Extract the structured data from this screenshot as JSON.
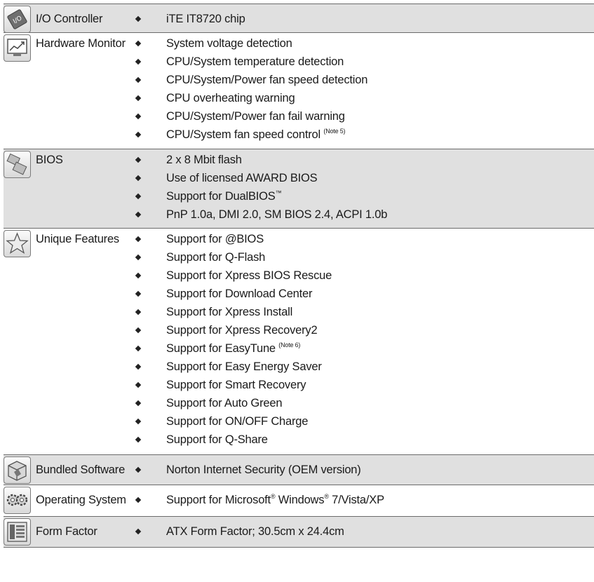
{
  "sections": [
    {
      "label": "I/O Controller",
      "icon": "io-chip-icon",
      "items": [
        "iTE IT8720 chip"
      ]
    },
    {
      "label": "Hardware Monitor",
      "icon": "monitor-graph-icon",
      "items": [
        "System voltage detection",
        "CPU/System temperature detection",
        "CPU/System/Power fan speed detection",
        "CPU overheating warning",
        "CPU/System/Power fan fail warning",
        "CPU/System fan speed control"
      ],
      "note": "(Note 5)"
    },
    {
      "label": "BIOS",
      "icon": "bios-chips-icon",
      "items": [
        "2 x 8 Mbit flash",
        "Use of licensed AWARD BIOS",
        "Support for DualBIOS",
        "PnP 1.0a, DMI 2.0, SM BIOS 2.4, ACPI 1.0b"
      ],
      "trademark": "™"
    },
    {
      "label": "Unique Features",
      "icon": "star-icon",
      "items": [
        "Support for @BIOS",
        "Support for Q-Flash",
        "Support for Xpress BIOS Rescue",
        "Support for Download Center",
        "Support for Xpress Install",
        "Support for Xpress Recovery2",
        "Support for EasyTune",
        "Support for Easy Energy Saver",
        "Support for Smart Recovery",
        "Support for Auto Green",
        "Support for ON/OFF Charge",
        "Support for Q-Share"
      ],
      "note": "(Note 6)"
    },
    {
      "label": "Bundled Software",
      "icon": "software-box-icon",
      "items": [
        "Norton Internet Security (OEM version)"
      ]
    },
    {
      "label": "Operating System",
      "icon": "gears-icon",
      "os": {
        "prefix": "Support for Microsoft",
        "reg1": "®",
        "middle": " Windows",
        "reg2": "®",
        "suffix": " 7/Vista/XP"
      }
    },
    {
      "label": "Form Factor",
      "icon": "motherboard-icon",
      "items": [
        "ATX Form Factor; 30.5cm x 24.4cm"
      ]
    }
  ],
  "colors": {
    "shade": "#e0e0e0",
    "rule": "#6b6b6b",
    "text": "#1a1a1a"
  }
}
